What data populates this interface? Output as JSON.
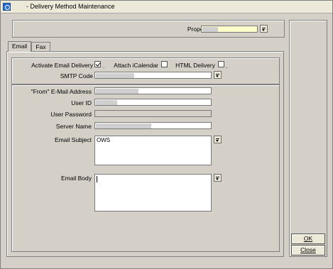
{
  "window": {
    "title": "- Delivery Method Maintenance"
  },
  "header": {
    "property_label": "Property"
  },
  "tabs": [
    {
      "label": "Email",
      "active": true
    },
    {
      "label": "Fax",
      "active": false
    }
  ],
  "email": {
    "activate_label": "Activate Email Delivery",
    "activate_checked": true,
    "ical_label": "Attach iCalendar",
    "ical_checked": false,
    "html_label": "HTML Delivery",
    "html_checked": false,
    "dot": ".",
    "smtp_label": "SMTP Code",
    "from_label": "\"From\" E-Mail Address",
    "userid_label": "User ID",
    "password_label": "User Password",
    "server_label": "Server Name",
    "subject_label": "Email Subject",
    "subject_value": "OWS",
    "body_label": "Email Body"
  },
  "buttons": {
    "ok": "OK",
    "close": "Close"
  },
  "colors": {
    "property_field": "#ffffcc",
    "dialog_bg": "#d4d0c8"
  }
}
